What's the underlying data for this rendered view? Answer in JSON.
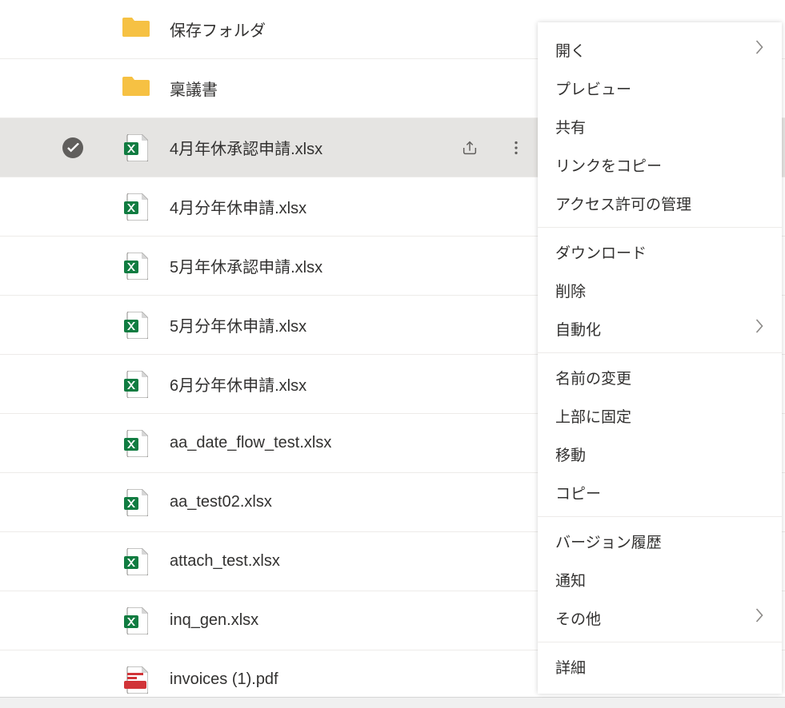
{
  "files": [
    {
      "name": "保存フォルダ",
      "type": "folder",
      "selected": false
    },
    {
      "name": "稟議書",
      "type": "folder",
      "selected": false
    },
    {
      "name": "4月年休承認申請.xlsx",
      "type": "xlsx",
      "selected": true
    },
    {
      "name": "4月分年休申請.xlsx",
      "type": "xlsx",
      "selected": false
    },
    {
      "name": "5月年休承認申請.xlsx",
      "type": "xlsx",
      "selected": false
    },
    {
      "name": "5月分年休申請.xlsx",
      "type": "xlsx",
      "selected": false
    },
    {
      "name": "6月分年休申請.xlsx",
      "type": "xlsx",
      "selected": false
    },
    {
      "name": "aa_date_flow_test.xlsx",
      "type": "xlsx",
      "selected": false
    },
    {
      "name": "aa_test02.xlsx",
      "type": "xlsx",
      "selected": false
    },
    {
      "name": "attach_test.xlsx",
      "type": "xlsx",
      "selected": false
    },
    {
      "name": "inq_gen.xlsx",
      "type": "xlsx",
      "selected": false
    },
    {
      "name": "invoices (1).pdf",
      "type": "pdf",
      "selected": false
    }
  ],
  "context_menu": {
    "open": "開く",
    "preview": "プレビュー",
    "share": "共有",
    "copy_link": "リンクをコピー",
    "manage_access": "アクセス許可の管理",
    "download": "ダウンロード",
    "delete": "削除",
    "automate": "自動化",
    "rename": "名前の変更",
    "pin_top": "上部に固定",
    "move": "移動",
    "copy": "コピー",
    "version_history": "バージョン履歴",
    "alert": "通知",
    "more": "その他",
    "details": "詳細"
  }
}
